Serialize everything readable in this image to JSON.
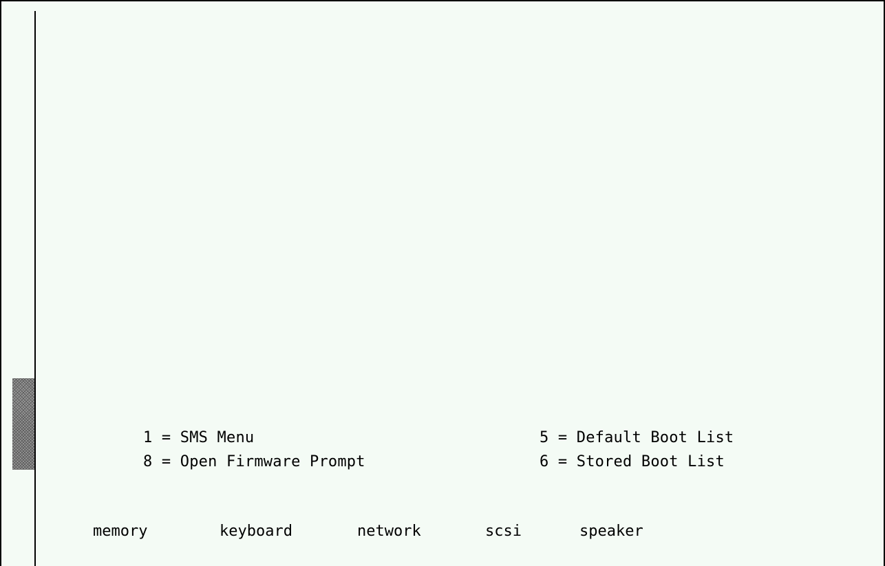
{
  "boot_menu": {
    "left": [
      {
        "key": "1",
        "label": "1 = SMS Menu"
      },
      {
        "key": "8",
        "label": "8 = Open Firmware Prompt"
      }
    ],
    "right": [
      {
        "key": "5",
        "label": "5 = Default Boot List"
      },
      {
        "key": "6",
        "label": "6 = Stored Boot List"
      }
    ]
  },
  "device_checks": [
    "memory",
    "keyboard",
    "network",
    "scsi",
    "speaker"
  ],
  "colors": {
    "background": "#f4fbf5",
    "text": "#000000",
    "scroll_thumb": "#9a9a9a"
  }
}
